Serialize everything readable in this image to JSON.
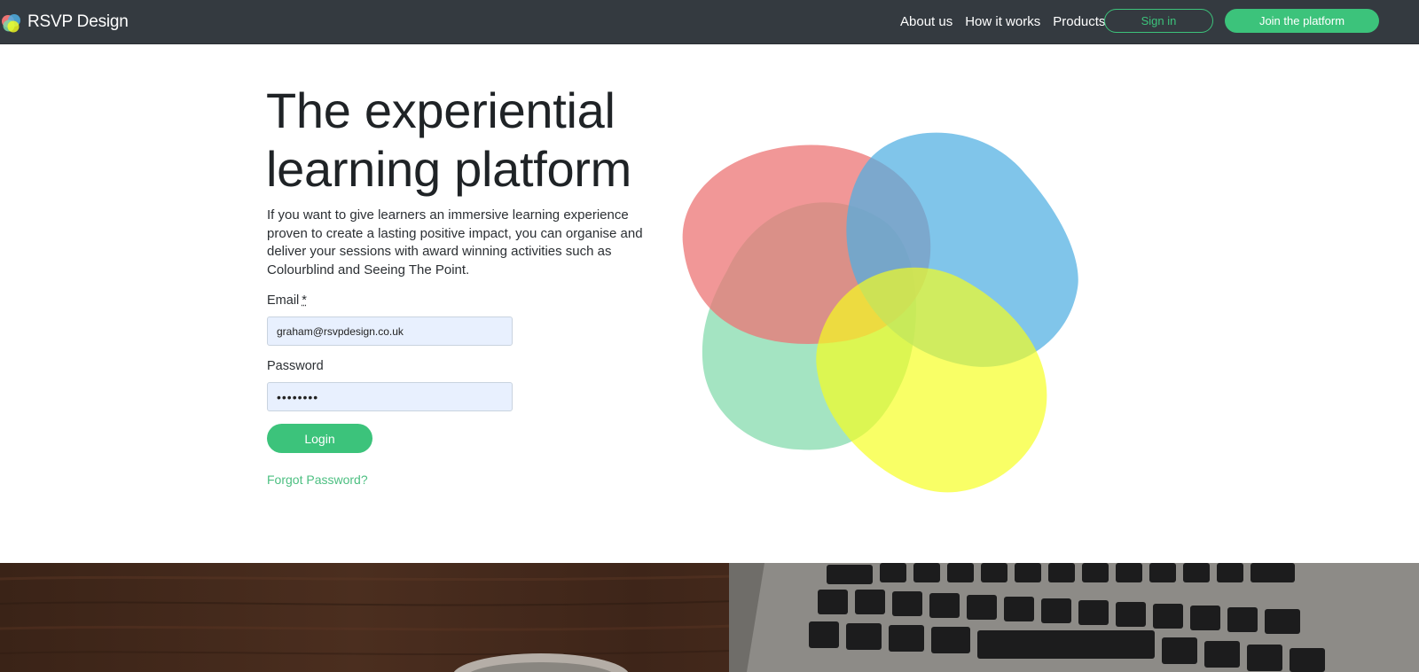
{
  "nav": {
    "brand": "RSVP Design",
    "links": [
      "About us",
      "How it works",
      "Products"
    ],
    "signin_label": "Sign in",
    "join_label": "Join the platform"
  },
  "hero": {
    "title": "The experiential learning platform",
    "description": "If you want to give learners an immersive learning experience proven to create a lasting positive impact, you can organise and deliver your sessions with award winning activities such as Colourblind and Seeing The Point."
  },
  "form": {
    "email_label": "Email",
    "required_mark": "*",
    "email_value": "graham@rsvpdesign.co.uk",
    "password_label": "Password",
    "password_value": "••••••••",
    "login_label": "Login",
    "forgot_label": "Forgot Password?"
  },
  "colors": {
    "navbar": "#343a40",
    "accent_green": "#3cc37b",
    "blob_red": "#ec7474",
    "blob_blue": "#4faee2",
    "blob_green": "#7dd9a8",
    "blob_yellow": "#f6ff1e",
    "input_bg": "#e8f0fe"
  },
  "icons": {
    "logo": "rsvp-circles-logo"
  }
}
